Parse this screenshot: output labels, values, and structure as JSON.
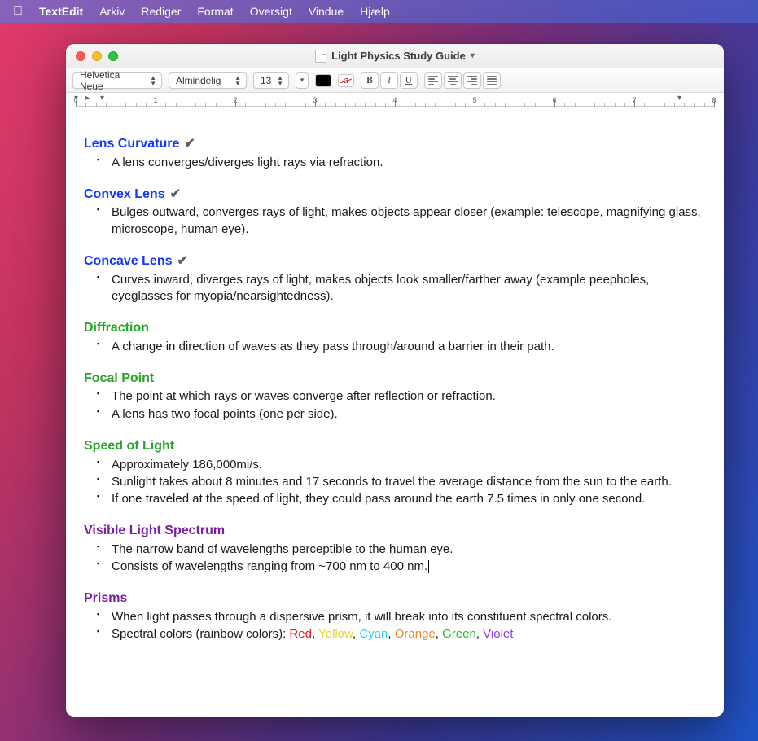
{
  "menubar": {
    "app": "TextEdit",
    "items": [
      "Arkiv",
      "Rediger",
      "Format",
      "Oversigt",
      "Vindue",
      "Hjælp"
    ]
  },
  "window": {
    "title": "Light Physics Study Guide"
  },
  "toolbar": {
    "font": "Helvetica Neue",
    "style": "Almindelig",
    "size": "13",
    "bold": "B",
    "italic": "I",
    "underline": "U"
  },
  "ruler": {
    "labels": [
      "0",
      "1",
      "2",
      "3",
      "4",
      "5",
      "6",
      "7",
      "8"
    ]
  },
  "doc": {
    "sections": [
      {
        "heading": "Lens Curvature",
        "color": "blue",
        "check": true,
        "items": [
          "A lens converges/diverges light rays via refraction."
        ]
      },
      {
        "heading": "Convex Lens",
        "color": "blue",
        "check": true,
        "items": [
          "Bulges outward, converges rays of light, makes objects appear closer (example: telescope, magnifying glass, microscope, human eye)."
        ]
      },
      {
        "heading": "Concave Lens",
        "color": "blue",
        "check": true,
        "items": [
          "Curves inward, diverges rays of light, makes objects look smaller/farther away (example peepholes, eyeglasses for myopia/nearsightedness)."
        ]
      },
      {
        "heading": "Diffraction",
        "color": "green",
        "check": false,
        "items": [
          "A change in direction of waves as they pass through/around a barrier in their path."
        ]
      },
      {
        "heading": "Focal Point",
        "color": "green",
        "check": false,
        "items": [
          "The point at which rays or waves converge after reflection or refraction.",
          "A lens has two focal points (one per side)."
        ]
      },
      {
        "heading": "Speed of Light",
        "color": "green",
        "check": false,
        "items": [
          "Approximately 186,000mi/s.",
          "Sunlight takes about 8 minutes and 17 seconds to travel the average distance from the sun to the earth.",
          "If one traveled at the speed of light, they could pass around the earth 7.5 times in only one second."
        ]
      },
      {
        "heading": "Visible Light Spectrum",
        "color": "purple",
        "check": false,
        "items": [
          "The narrow band of wavelengths perceptible to the human eye.",
          "Consists of wavelengths ranging from ~700 nm to 400 nm."
        ],
        "cursor_after_item": 1
      },
      {
        "heading": "Prisms",
        "color": "purple",
        "check": false,
        "items": [
          "When light passes through a dispersive prism, it will break into its constituent spectral colors."
        ],
        "spectral_line": {
          "prefix": "Spectral colors (rainbow colors): ",
          "colors": [
            {
              "text": "Red",
              "class": "c-red"
            },
            {
              "text": "Yellow",
              "class": "c-yellow"
            },
            {
              "text": "Cyan",
              "class": "c-cyan"
            },
            {
              "text": "Orange",
              "class": "c-orange"
            },
            {
              "text": "Green",
              "class": "c-green"
            },
            {
              "text": "Violet",
              "class": "c-violet"
            }
          ]
        }
      }
    ]
  }
}
